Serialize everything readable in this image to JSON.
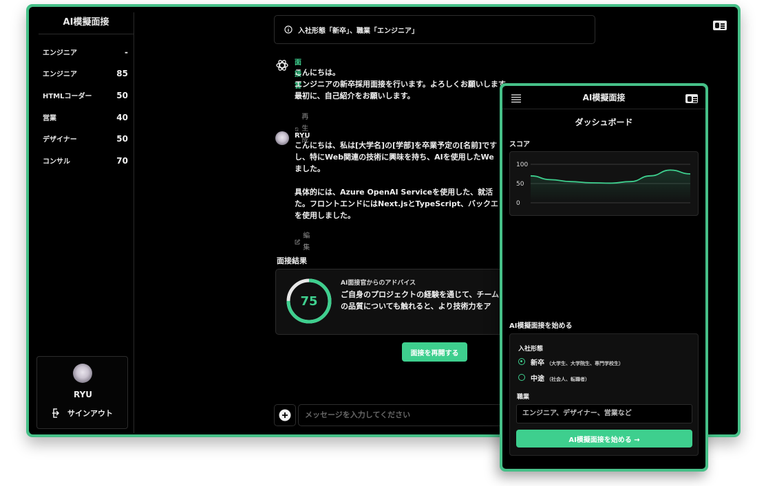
{
  "sidebar": {
    "title": "AI模擬面接",
    "items": [
      {
        "label": "エンジニア",
        "score": "-"
      },
      {
        "label": "エンジニア",
        "score": "85"
      },
      {
        "label": "HTMLコーダー",
        "score": "50"
      },
      {
        "label": "営業",
        "score": "40"
      },
      {
        "label": "デザイナー",
        "score": "50"
      },
      {
        "label": "コンサル",
        "score": "70"
      }
    ],
    "user_name": "RYU",
    "signout_label": "サインアウト"
  },
  "info_banner": "入社形態「新卒」、職業「エンジニア」",
  "messages": [
    {
      "sender": "面接官",
      "text": "こんにちは。\nエンジニアの新卒採用面接を行います。よろしくお願いします。\n最初に、自己紹介をお願いします。",
      "action": "再生成"
    },
    {
      "sender": "RYU",
      "text": "こんにちは、私は[大学名]の[学部]を卒業予定の[名前]です\nし、特にWeb関連の技術に興味を持ち、AIを使用したWe\nました。\n\n具体的には、Azure OpenAI Serviceを使用した、就活\nた。フロントエンドにはNext.jsとTypeScript、バックエ\nを使用しました。",
      "action": "編集"
    }
  ],
  "result": {
    "section_title": "面接結果",
    "score": 75,
    "advice_label": "AI面接官からのアドバイス",
    "advice_text": "ご自身のプロジェクトの経験を通じて、チーム\nの品質についても触れると、より技術力をア"
  },
  "restart_button": "面接を再開する",
  "message_input": {
    "placeholder": "メッセージを入力してください"
  },
  "phone": {
    "title": "AI模擬面接",
    "dashboard_title": "ダッシュボード",
    "score_label": "スコア",
    "start_section_title": "AI模擬面接を始める",
    "entry_type_label": "入社形態",
    "options": [
      {
        "label": "新卒",
        "sub": "（大学生、大学院生、専門学校生）",
        "selected": true
      },
      {
        "label": "中途",
        "sub": "（社会人、転職者）",
        "selected": false
      }
    ],
    "job_label": "職業",
    "job_placeholder": "エンジニア、デザイナー、営業など",
    "start_button": "AI模擬面接を始める →"
  },
  "chart_data": {
    "type": "area",
    "title": "スコア",
    "y_ticks": [
      "100",
      "50",
      "0"
    ],
    "ylim": [
      0,
      100
    ],
    "series": [
      {
        "values": [
          70,
          60,
          55,
          52,
          51,
          55,
          70,
          85,
          75
        ]
      }
    ],
    "grid": true,
    "legend": "none"
  },
  "colors": {
    "accent": "#3ecf8e",
    "frame": "#46c088",
    "background": "#000000"
  }
}
